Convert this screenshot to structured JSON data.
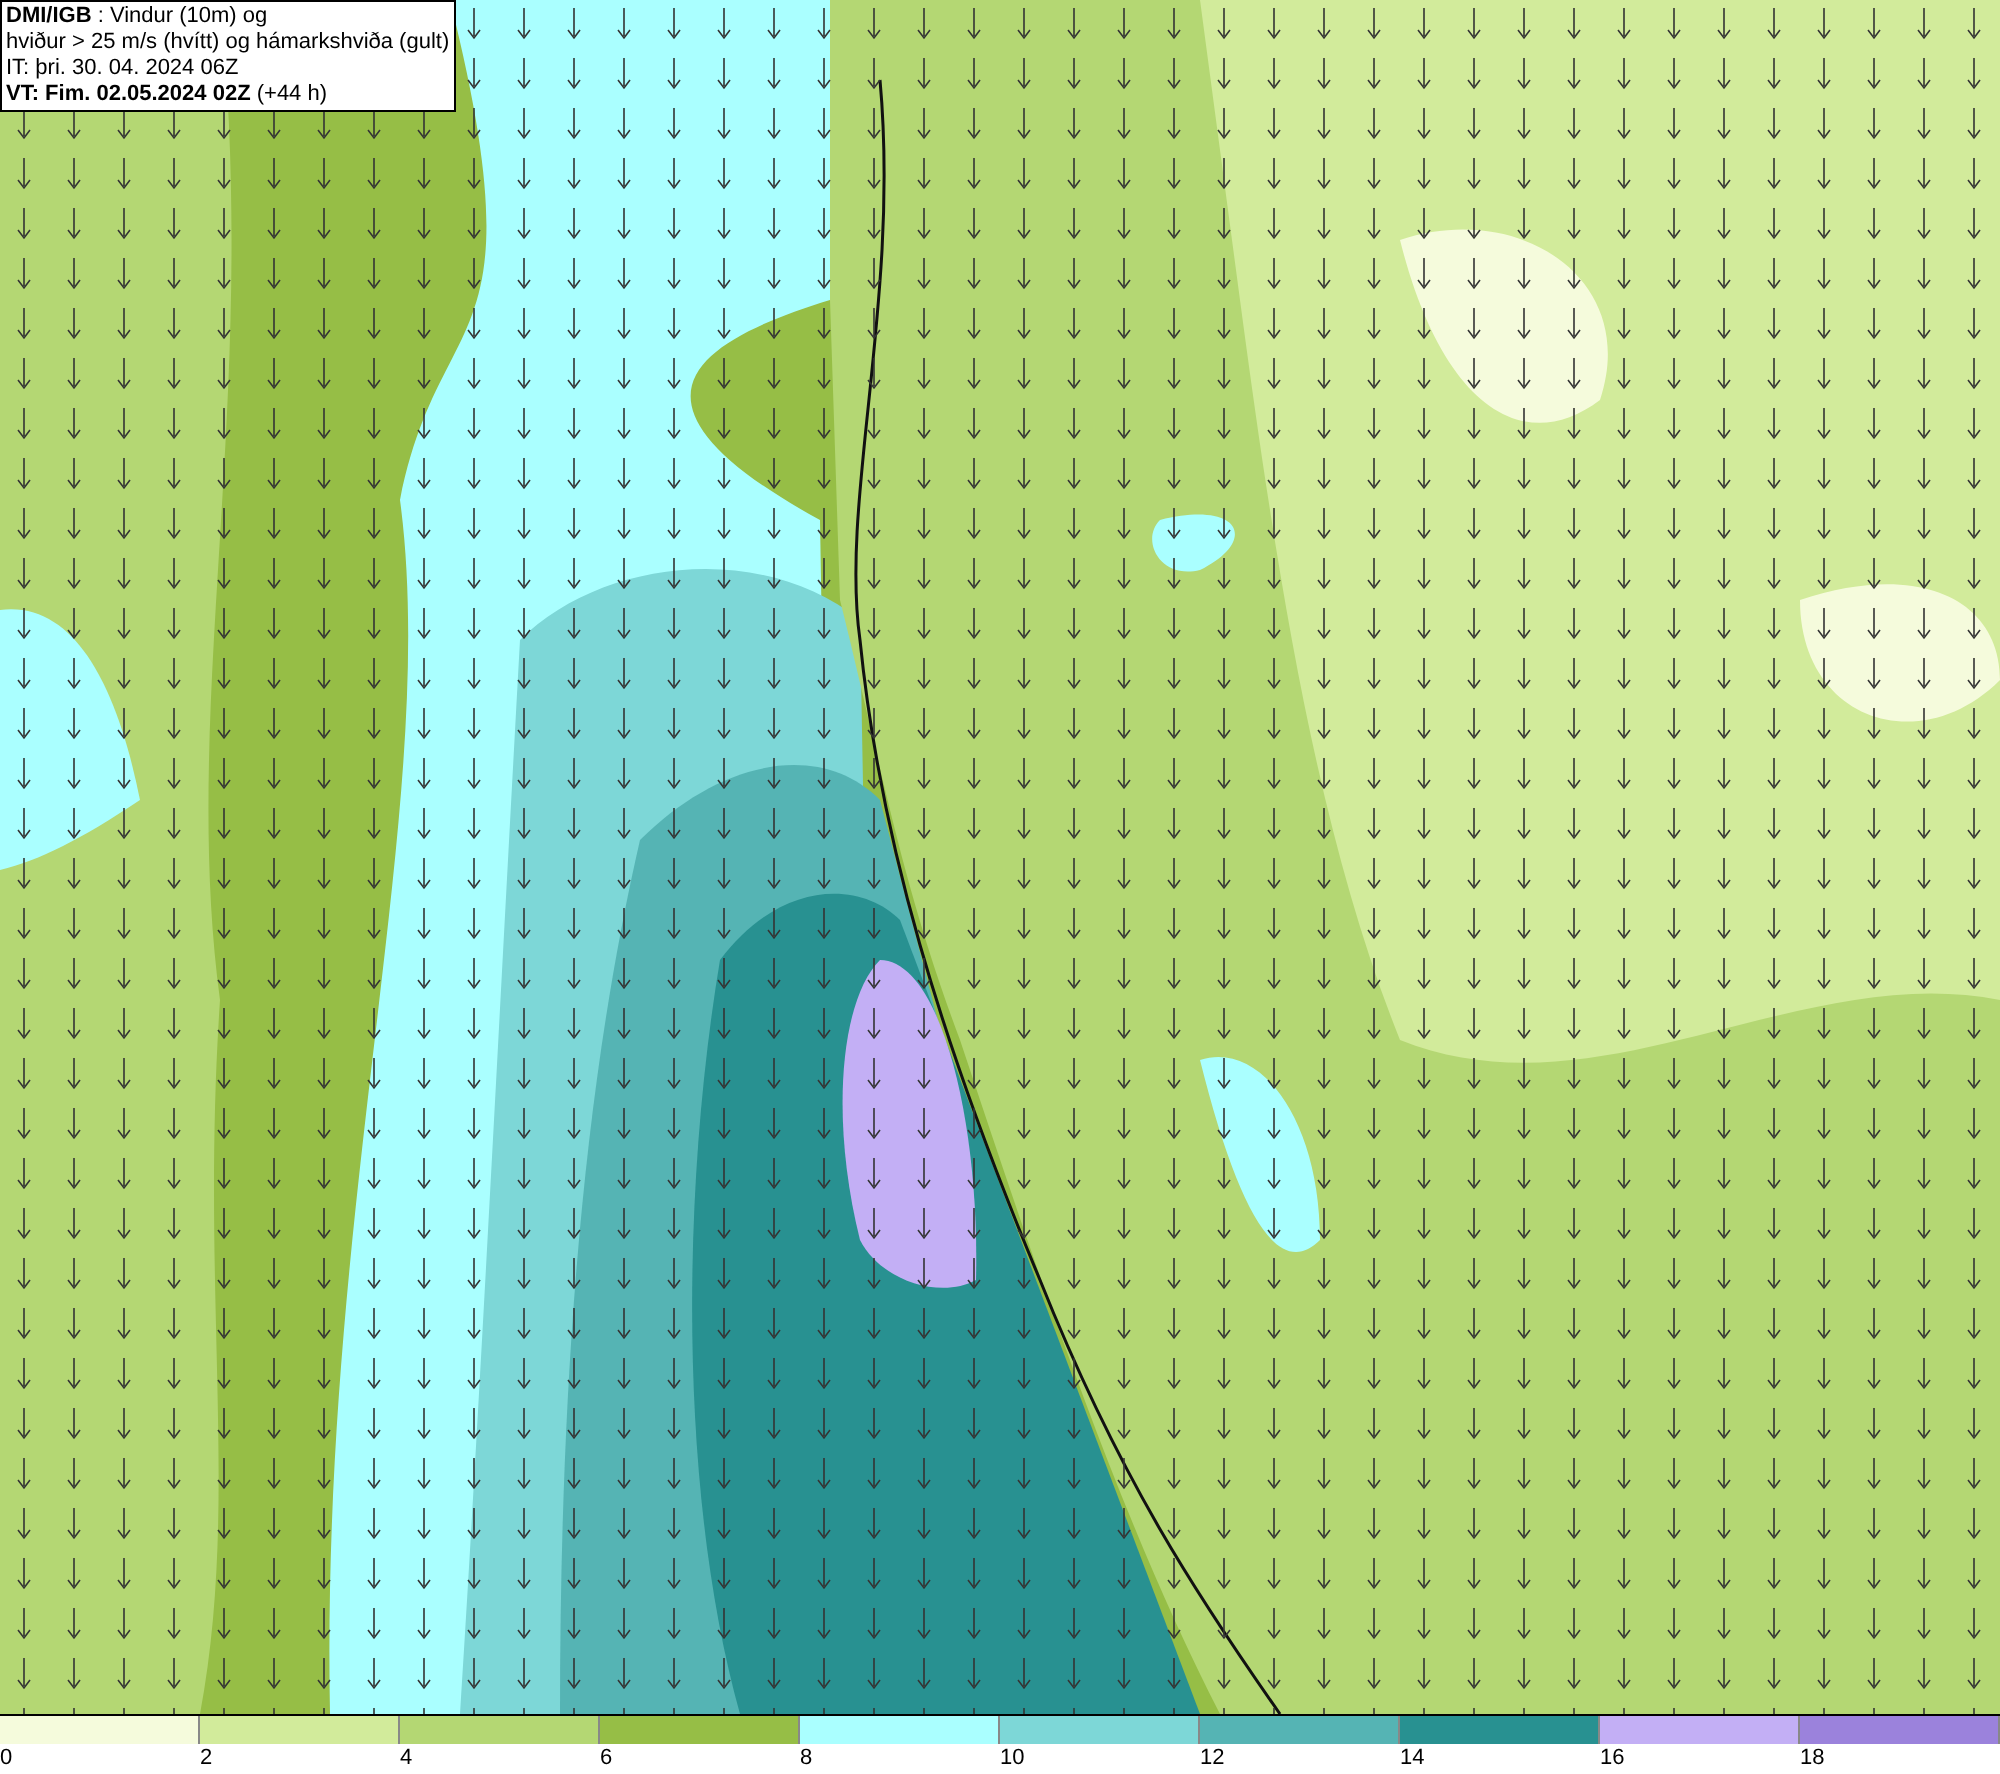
{
  "header": {
    "lines": [
      "**DMI/IGB** : Vindur (10m) og",
      "hviður > 25 m/s (hvítt) og hámarkshviða (gult)",
      "IT: þri. 30. 04. 2024 06Z",
      "**VT: Fim. 02.05.2024 02Z** (+44 h)"
    ]
  },
  "legend": {
    "bands": [
      {
        "color": "#f5fbdc"
      },
      {
        "color": "#d2eb9b"
      },
      {
        "color": "#b4d773"
      },
      {
        "color": "#96be46"
      },
      {
        "color": "#aaffff"
      },
      {
        "color": "#7dd7d7"
      },
      {
        "color": "#55b4b4"
      },
      {
        "color": "#289191"
      },
      {
        "color": "#c3aff5"
      },
      {
        "color": "#9b82dc"
      }
    ],
    "ticks": [
      "0",
      "2",
      "4",
      "6",
      "8",
      "10",
      "12",
      "14",
      "16",
      "18"
    ]
  }
}
